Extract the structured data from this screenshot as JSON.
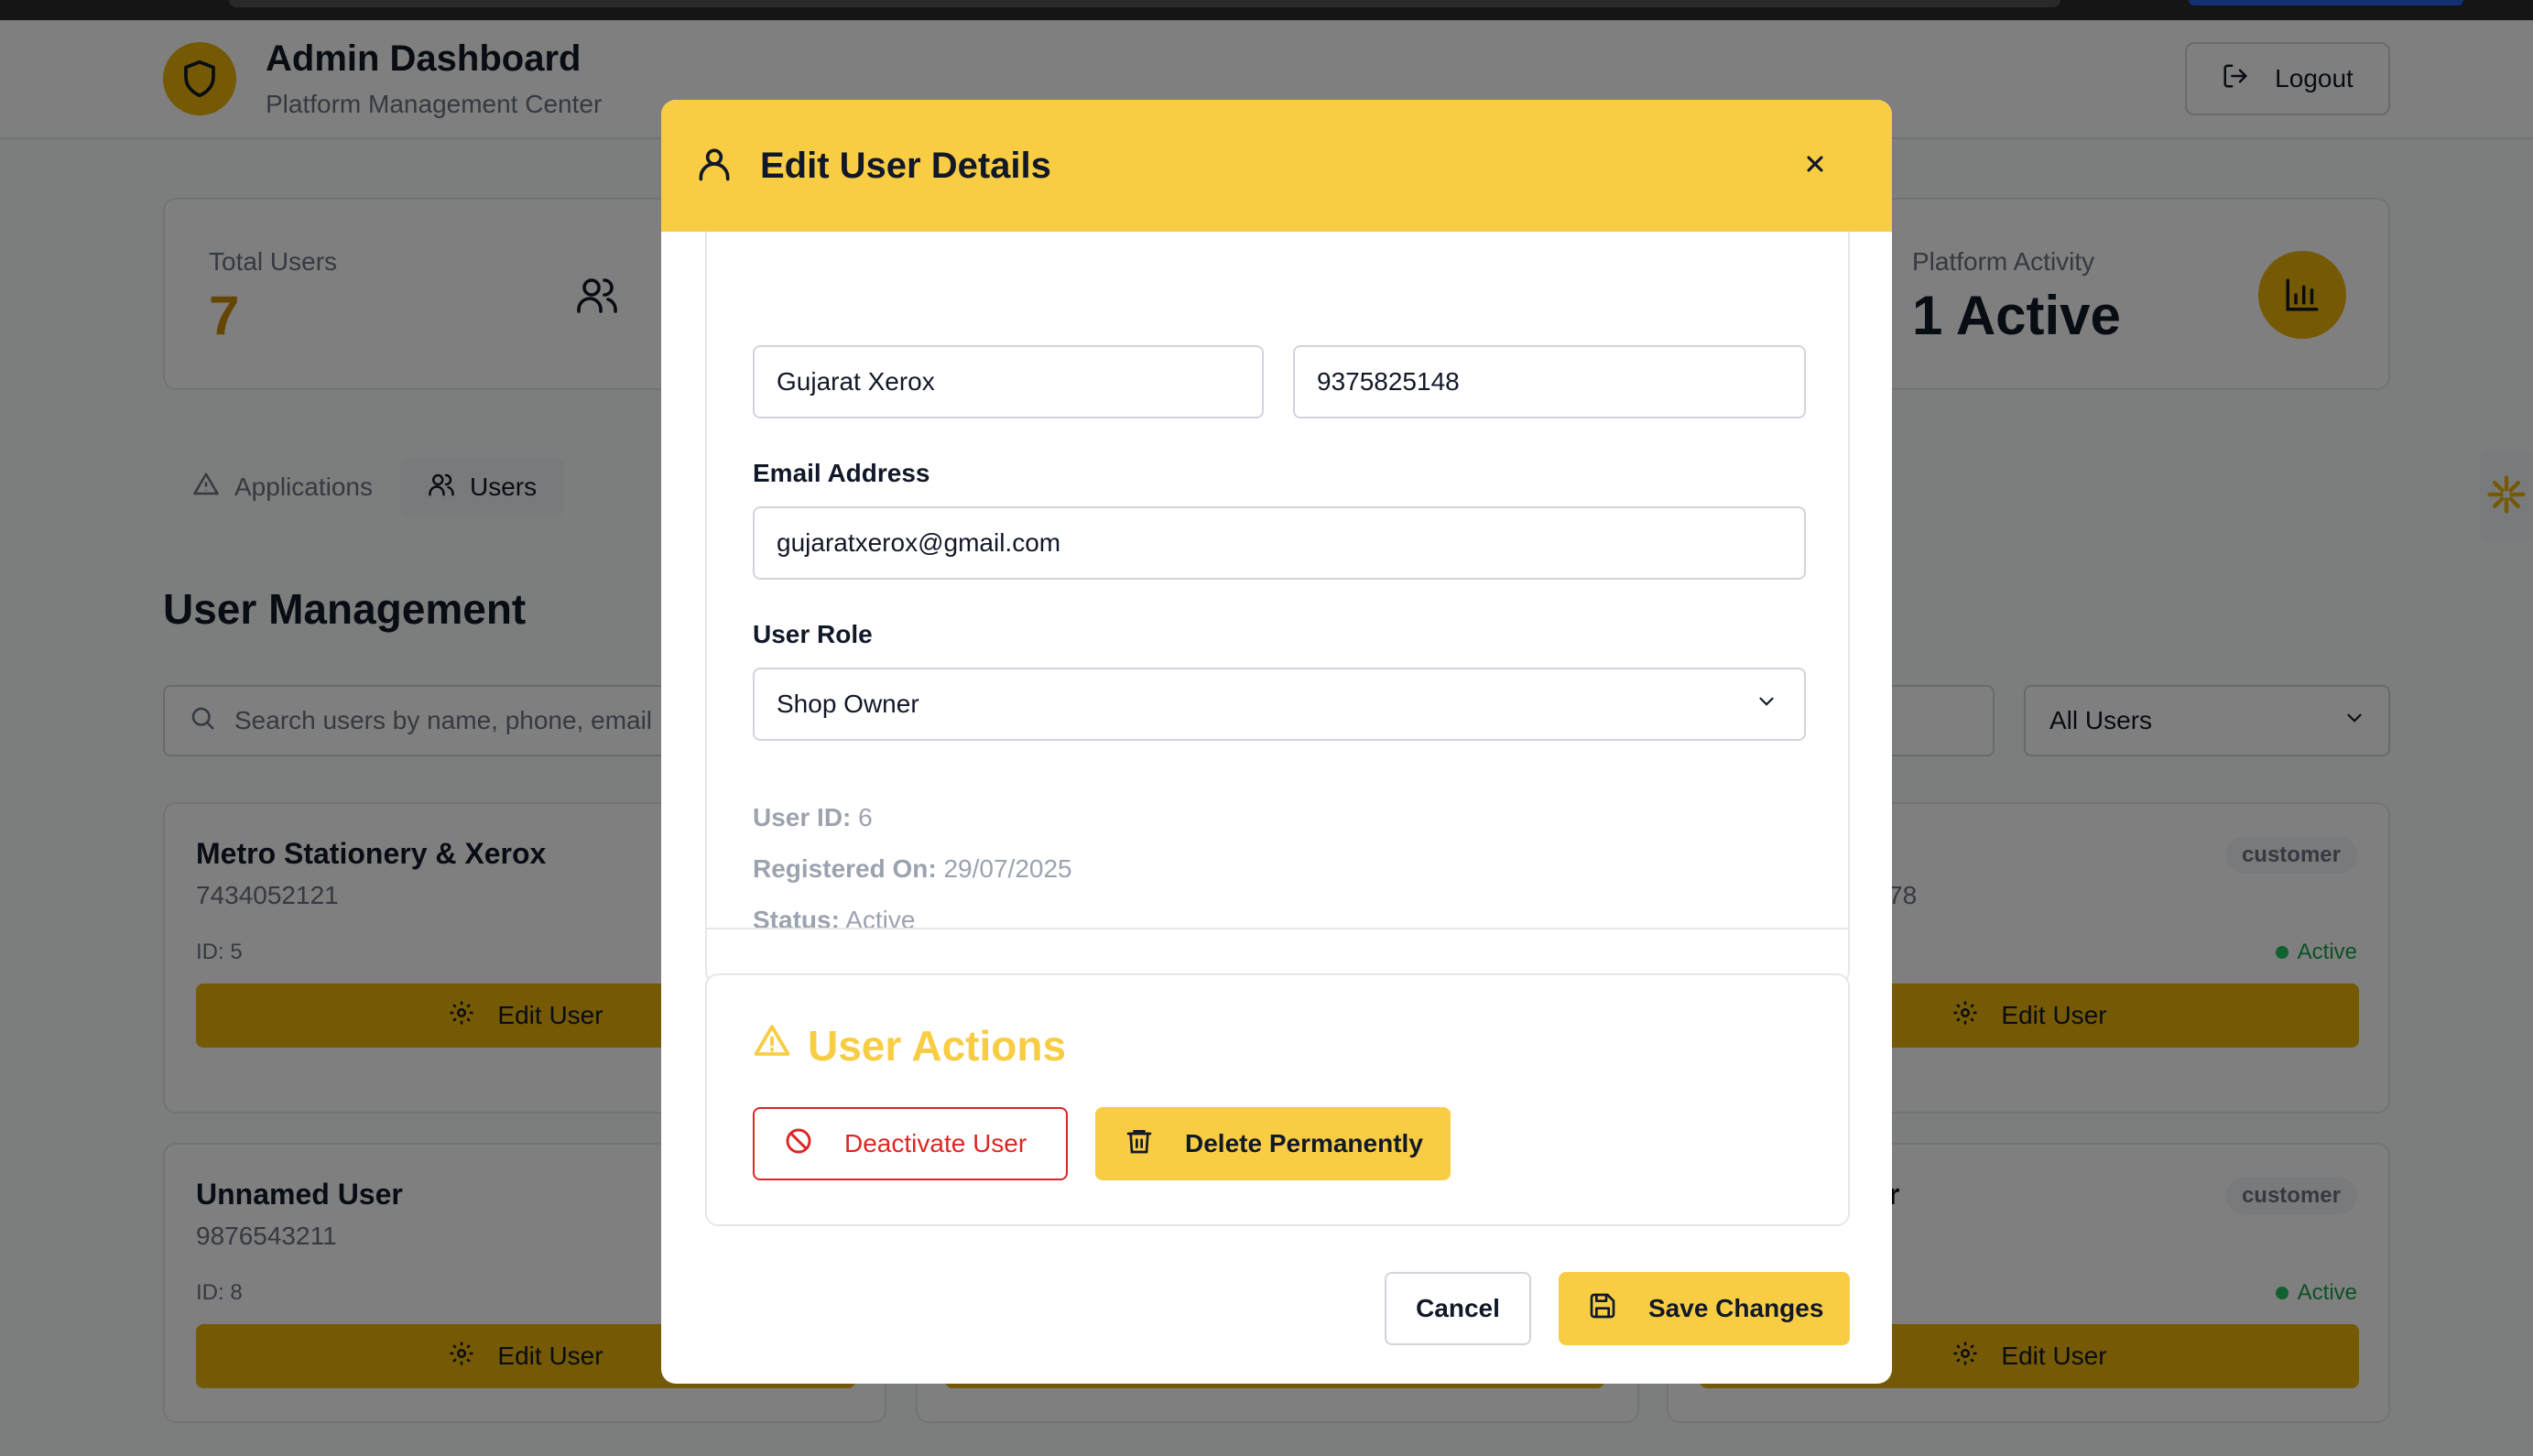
{
  "header": {
    "title": "Admin Dashboard",
    "subtitle": "Platform Management Center",
    "logout_label": "Logout"
  },
  "stats": {
    "total_users_label": "Total Users",
    "total_users_value": "7",
    "activity_label": "Platform Activity",
    "activity_value": "1 Active"
  },
  "tabs": [
    {
      "label": "Applications",
      "icon": "warning-icon"
    },
    {
      "label": "Users",
      "icon": "users-icon",
      "active": true
    }
  ],
  "management": {
    "title": "User Management",
    "search_placeholder": "Search users by name, phone, email",
    "filter_value": "All Users"
  },
  "user_cards": [
    {
      "name": "Metro Stationery & Xerox",
      "phone": "7434052121",
      "id": "ID: 5",
      "button": "Edit User"
    },
    {
      "name": "",
      "phone": "78",
      "id": "",
      "role": "customer",
      "status": "Active",
      "button": "Edit User"
    },
    {
      "name": "Unnamed User",
      "phone": "9876543211",
      "id": "ID: 8",
      "button": "Edit User"
    },
    {
      "name": "r",
      "phone": "",
      "id": "",
      "role": "customer",
      "status": "Active",
      "button": "Edit User"
    }
  ],
  "modal": {
    "title": "Edit User Details",
    "name_value": "Gujarat Xerox",
    "phone_value": "9375825148",
    "email_label": "Email Address",
    "email_value": "gujaratxerox@gmail.com",
    "role_label": "User Role",
    "role_value": "Shop Owner",
    "user_id_label": "User ID:",
    "user_id_value": "6",
    "registered_label": "Registered On:",
    "registered_value": "29/07/2025",
    "status_label": "Status:",
    "status_value": "Active",
    "actions_title": "User Actions",
    "deactivate_label": "Deactivate User",
    "delete_label": "Delete Permanently",
    "cancel_label": "Cancel",
    "save_label": "Save Changes"
  },
  "colors": {
    "accent": "#f8cd44",
    "danger": "#dc2626",
    "success": "#22c55e",
    "background_brand": "#eab308"
  }
}
